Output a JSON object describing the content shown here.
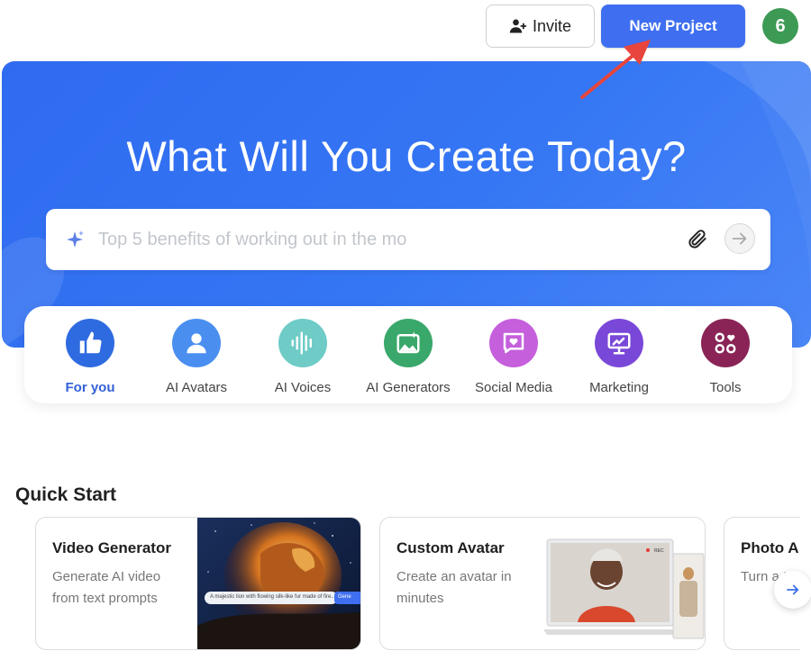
{
  "header": {
    "invite_label": "Invite",
    "new_project_label": "New Project",
    "avatar_initial": "6",
    "avatar_color": "#3d9a54",
    "accent_color": "#3f6ff0"
  },
  "hero": {
    "title": "What Will You Create Today?",
    "search_placeholder": "Top 5 benefits of working out in the mo",
    "attach_icon": "paperclip-icon",
    "send_icon": "arrow-right-icon"
  },
  "categories": [
    {
      "label": "For you",
      "icon": "thumbs-up-icon",
      "color": "#2f6be0",
      "active": true
    },
    {
      "label": "AI Avatars",
      "icon": "user-icon",
      "color": "#4a8ff0",
      "active": false
    },
    {
      "label": "AI Voices",
      "icon": "waveform-icon",
      "color": "#6ecbc6",
      "active": false
    },
    {
      "label": "AI Generators",
      "icon": "image-sparkle-icon",
      "color": "#3aa86a",
      "active": false
    },
    {
      "label": "Social Media",
      "icon": "heart-chat-icon",
      "color": "#c55fdc",
      "active": false
    },
    {
      "label": "Marketing",
      "icon": "chart-presentation-icon",
      "color": "#7a48d8",
      "active": false
    },
    {
      "label": "Tools",
      "icon": "tools-grid-icon",
      "color": "#8a2456",
      "active": false
    }
  ],
  "quick_start": {
    "title": "Quick Start",
    "cards": [
      {
        "title": "Video Generator",
        "description": "Generate AI video from text prompts",
        "image_caption": "A majestic lion with flowing silk-like fur made of fire...",
        "image_button": "Gene"
      },
      {
        "title": "Custom Avatar",
        "description": "Create an avatar in minutes",
        "image_rec": "REC"
      },
      {
        "title": "Photo A",
        "description": "Turn a talkin"
      }
    ]
  }
}
